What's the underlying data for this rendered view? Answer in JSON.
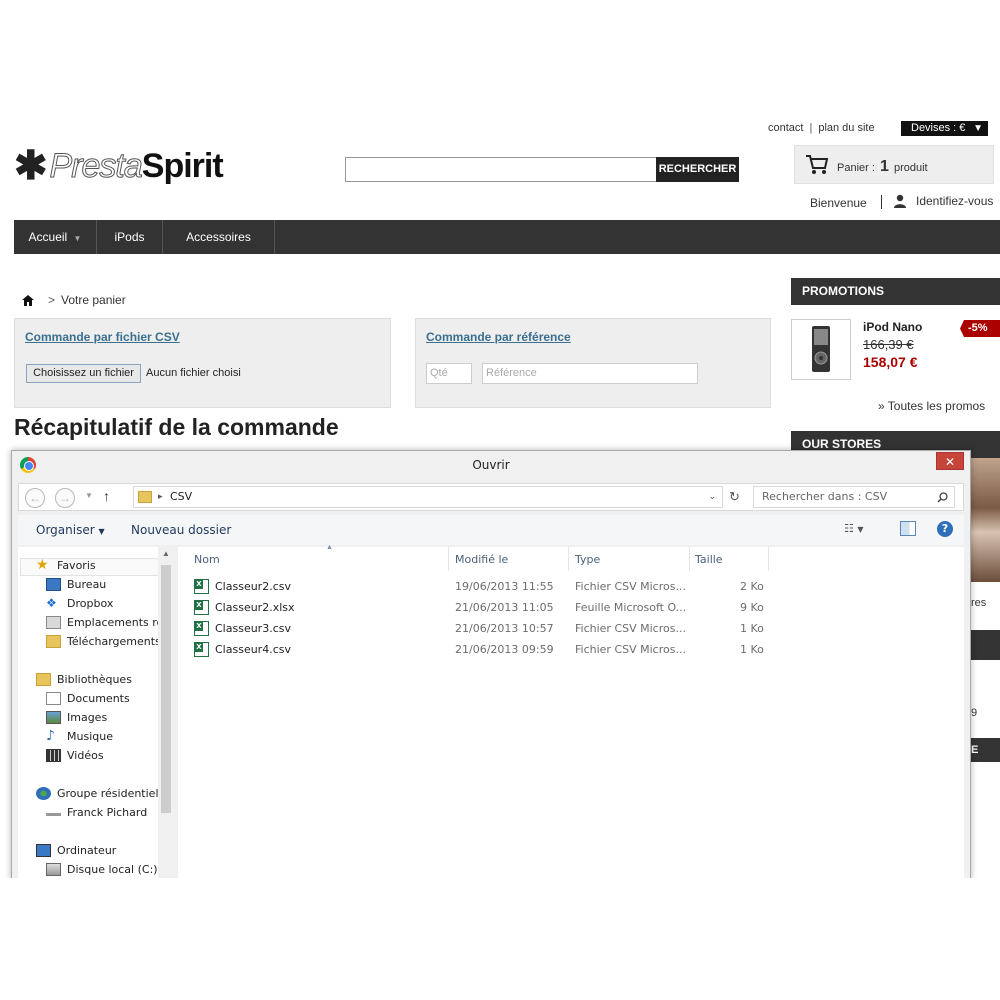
{
  "header": {
    "links": [
      "contact",
      "plan du site"
    ],
    "currency": "Devises : €",
    "search_button": "RECHERCHER",
    "logo_light": "Presta",
    "logo_bold": "Spirit",
    "cart": {
      "label": "Panier :",
      "count": "1",
      "unit": "produit"
    },
    "welcome": "Bienvenue",
    "login": "Identifiez-vous"
  },
  "nav": [
    {
      "label": "Accueil"
    },
    {
      "label": "iPods"
    },
    {
      "label": "Accessoires"
    }
  ],
  "breadcrumb": {
    "separator": ">",
    "current": "Votre panier"
  },
  "csv_box": {
    "title": "Commande par fichier CSV",
    "file_button": "Choisissez un fichier",
    "file_status": "Aucun fichier choisi"
  },
  "ref_box": {
    "title": "Commande par référence",
    "qty_placeholder": "Qté",
    "ref_placeholder": "Référence"
  },
  "page_title": "Récapitulatif de la commande",
  "sidebar": {
    "promotions_title": "PROMOTIONS",
    "promo": {
      "name": "iPod Nano",
      "old_price": "166,39 €",
      "new_price": "158,07 €",
      "badge": "-5%"
    },
    "all_promos": "» Toutes les promos",
    "stores_title": "OUR STORES",
    "stub_texts": [
      "res",
      "9",
      "E"
    ]
  },
  "dialog": {
    "title": "Ouvrir",
    "close": "✕",
    "path": "CSV",
    "search_placeholder": "Rechercher dans : CSV",
    "toolbar": {
      "organize": "Organiser",
      "new_folder": "Nouveau dossier"
    },
    "nav_pane": {
      "favorites": "Favoris",
      "favorite_items": [
        "Bureau",
        "Dropbox",
        "Emplacements réc",
        "Téléchargements"
      ],
      "libraries": "Bibliothèques",
      "library_items": [
        "Documents",
        "Images",
        "Musique",
        "Vidéos"
      ],
      "homegroup": "Groupe résidentiel",
      "homegroup_items": [
        "Franck Pichard"
      ],
      "computer": "Ordinateur",
      "computer_items": [
        "Disque local (C:)"
      ]
    },
    "columns": [
      "Nom",
      "Modifié le",
      "Type",
      "Taille"
    ],
    "files": [
      {
        "name": "Classeur2.csv",
        "modified": "19/06/2013 11:55",
        "type": "Fichier CSV Micros...",
        "size": "2 Ko"
      },
      {
        "name": "Classeur2.xlsx",
        "modified": "21/06/2013 11:05",
        "type": "Feuille Microsoft O...",
        "size": "9 Ko"
      },
      {
        "name": "Classeur3.csv",
        "modified": "21/06/2013 10:57",
        "type": "Fichier CSV Micros...",
        "size": "1 Ko"
      },
      {
        "name": "Classeur4.csv",
        "modified": "21/06/2013 09:59",
        "type": "Fichier CSV Micros...",
        "size": "1 Ko"
      }
    ]
  }
}
